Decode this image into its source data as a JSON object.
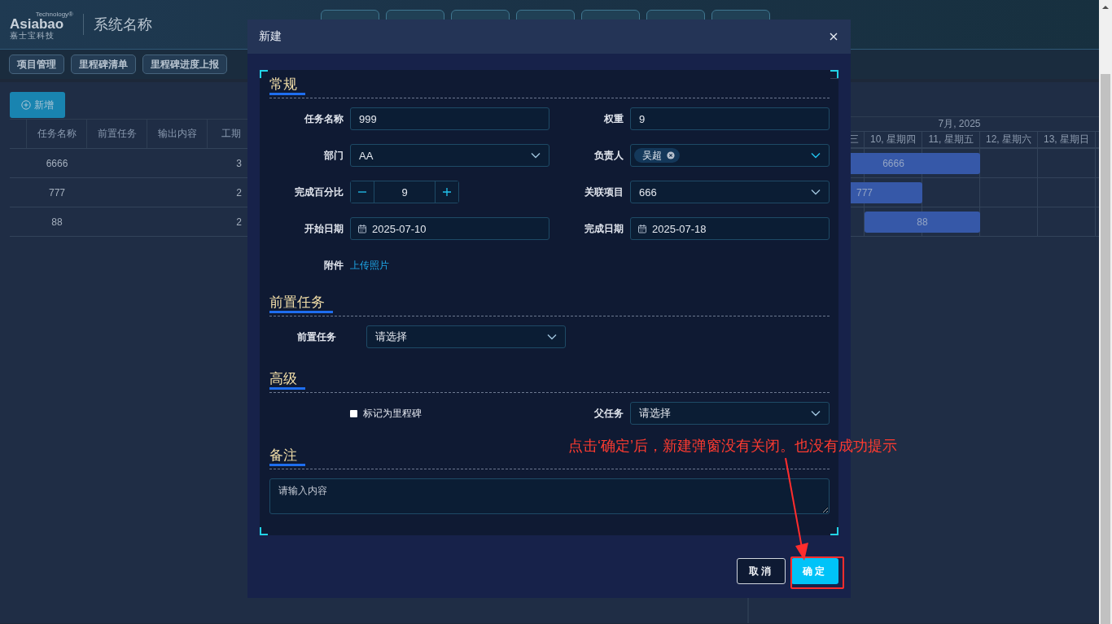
{
  "header": {
    "logo_sup": "Technology®",
    "logo_name": "Asiabao",
    "logo_cn": "嘉士宝科技",
    "system_name": "系统名称"
  },
  "subnav": [
    {
      "label": "项目管理"
    },
    {
      "label": "里程碑清单"
    },
    {
      "label": "里程碑进度上报"
    }
  ],
  "add_button": "新增",
  "table": {
    "columns": [
      "任务名称",
      "前置任务",
      "输出内容",
      "工期"
    ],
    "rows": [
      {
        "name": "6666",
        "duration": "3"
      },
      {
        "name": "777",
        "duration": "2"
      },
      {
        "name": "88",
        "duration": "2"
      }
    ]
  },
  "gantt": {
    "month": "7月, 2025",
    "days": [
      "三",
      "10, 星期四",
      "11, 星期五",
      "12, 星期六",
      "13, 星期日"
    ],
    "bars": [
      "6666",
      "777",
      "88"
    ]
  },
  "dialog": {
    "title": "新建",
    "sections": [
      {
        "title": "常规",
        "kind": "grid",
        "fields": [
          {
            "kind": "input",
            "label": "任务名称",
            "value": "999"
          },
          {
            "kind": "input",
            "label": "权重",
            "value": "9"
          },
          {
            "kind": "select",
            "label": "部门",
            "value": "AA"
          },
          {
            "kind": "tags",
            "label": "负责人",
            "tags": [
              "吴超"
            ]
          },
          {
            "kind": "stepper",
            "label": "完成百分比",
            "value": "9"
          },
          {
            "kind": "select",
            "label": "关联项目",
            "value": "666"
          },
          {
            "kind": "date",
            "label": "开始日期",
            "value": "2025-07-10"
          },
          {
            "kind": "date",
            "label": "完成日期",
            "value": "2025-07-18"
          },
          {
            "kind": "link",
            "label": "附件",
            "value": "上传照片"
          }
        ]
      },
      {
        "title": "前置任务",
        "kind": "single",
        "fields": [
          {
            "kind": "select",
            "label": "前置任务",
            "placeholder": "请选择"
          }
        ]
      },
      {
        "title": "高级",
        "kind": "grid",
        "fields": [
          {
            "kind": "checkbox",
            "label": "标记为里程碑",
            "checked": false
          },
          {
            "kind": "select",
            "label": "父任务",
            "placeholder": "请选择"
          }
        ]
      },
      {
        "title": "备注",
        "kind": "notes",
        "fields": [
          {
            "kind": "textarea",
            "placeholder": "请输入内容"
          }
        ]
      }
    ],
    "buttons": [
      {
        "label": "取消",
        "kind": "secondary"
      },
      {
        "label": "确定",
        "kind": "primary"
      }
    ]
  },
  "annotation": {
    "text": "点击‘确定’后，新建弹窗没有关闭。也没有成功提示"
  }
}
